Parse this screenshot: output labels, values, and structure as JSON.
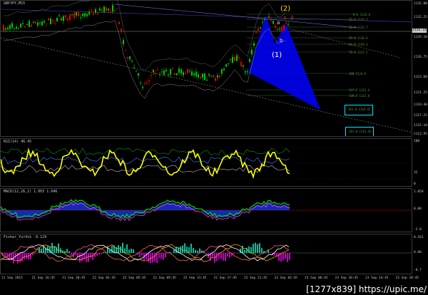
{
  "main": {
    "title": "GBPJPY,M15",
    "price_ticks": [
      "1135.80",
      "1132.25",
      "1129.10",
      "1126.75",
      "1123.60",
      "1121.25",
      "1119.40",
      "1117.25",
      "1115.10",
      "1113.95"
    ],
    "current_price": "1132.14",
    "waves": [
      {
        "label": "(2)",
        "color": "#ffd700"
      },
      {
        "label": "(1)",
        "color": "#ffffff"
      },
      {
        "label": "a",
        "color": "#e0e0e0"
      },
      {
        "label": "b",
        "color": "#e0e0e0"
      },
      {
        "label": "c",
        "color": "#ff4040"
      },
      {
        "label": "2",
        "color": "#ff4040"
      }
    ],
    "fib_levels": [
      "0.0 1134.6",
      "23.6 1133.5",
      "38.2 1131.7",
      "50.0 1130.6",
      "61.8 1129.3",
      "78.6 1127.5",
      "100 1124.6",
      "127.2 1123.4",
      "138.2 1122.8"
    ],
    "targets": [
      "161.8 1119.47",
      "261.8 1114.45"
    ]
  },
  "rsi": {
    "label": "RSI(14) 46.45",
    "ticks": [
      "100",
      "32",
      "0"
    ]
  },
  "macd": {
    "label": "MACD(12,26,2) 1.003 1.046",
    "ticks": [
      "1.859",
      "0.00",
      "-2.0"
    ]
  },
  "fisher": {
    "label": "Fisher_Yur4ik -0.129",
    "ticks": [
      "0.561",
      "0.00",
      "-0.7"
    ]
  },
  "time_labels": [
    "21 Sep 2015",
    "21 Sep 16:45",
    "21 Sep 20:45",
    "22 Sep 01:45",
    "22 Sep 05:45",
    "22 Sep 09:45",
    "22 Sep 13:45",
    "22 Sep 17:45",
    "22 Sep 21:45",
    "23 Sep 02:45",
    "23 Sep 06:45",
    "23 Sep 10:45",
    "23 Sep 14:45",
    "23 Sep 18:45"
  ],
  "watermark": "[1277x839] https://upic.me/",
  "colors": {
    "bull": "#00c800",
    "bear": "#e00000",
    "rsi": "#ffff00",
    "pattern": "#0000ff",
    "target_box": "#00e5ff"
  }
}
